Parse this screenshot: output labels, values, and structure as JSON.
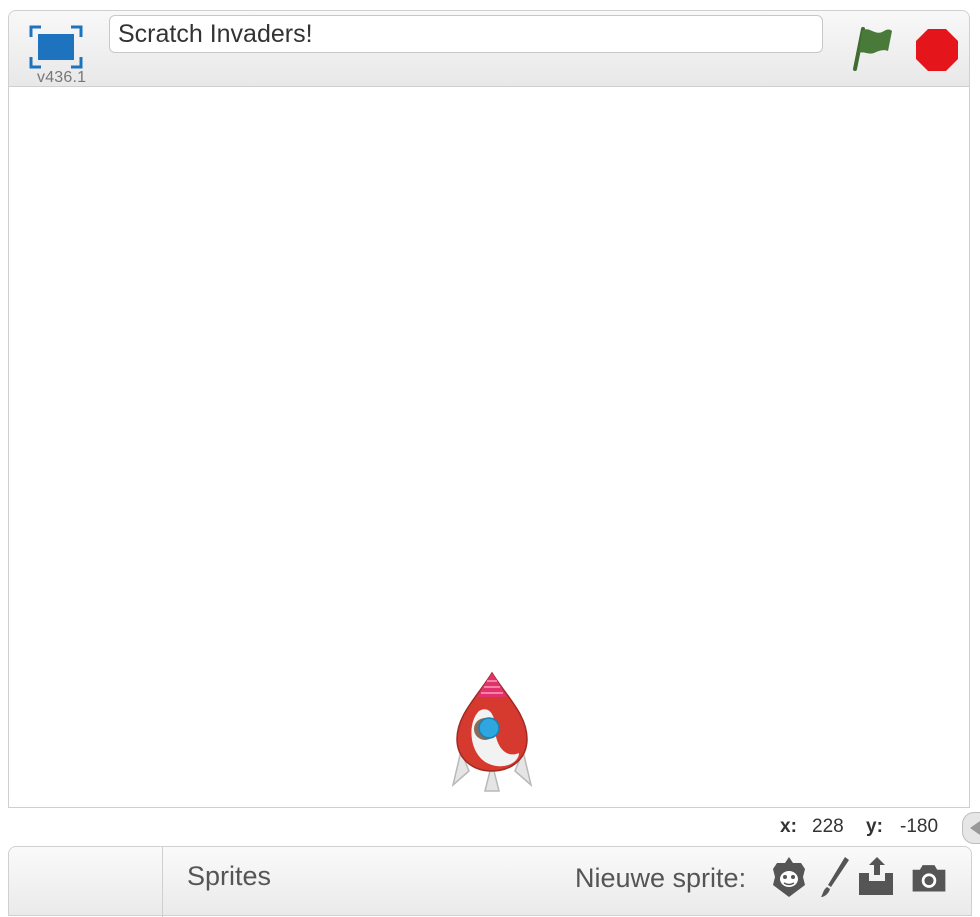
{
  "header": {
    "version": "v436.1",
    "project_title": "Scratch Invaders!"
  },
  "stage": {
    "mouse": {
      "x_label": "x:",
      "x_value": "228",
      "y_label": "y:",
      "y_value": "-180"
    }
  },
  "sprite_pane": {
    "tab_label": "Sprites",
    "new_sprite_label": "Nieuwe sprite:",
    "tools": [
      "choose-from-library-icon",
      "paint-brush-icon",
      "upload-icon",
      "camera-icon"
    ]
  },
  "colors": {
    "accent_blue": "#1e73be",
    "flag_green": "#4a7a3a",
    "stop_red": "#e4151b",
    "rocket_red": "#d63a2f"
  }
}
